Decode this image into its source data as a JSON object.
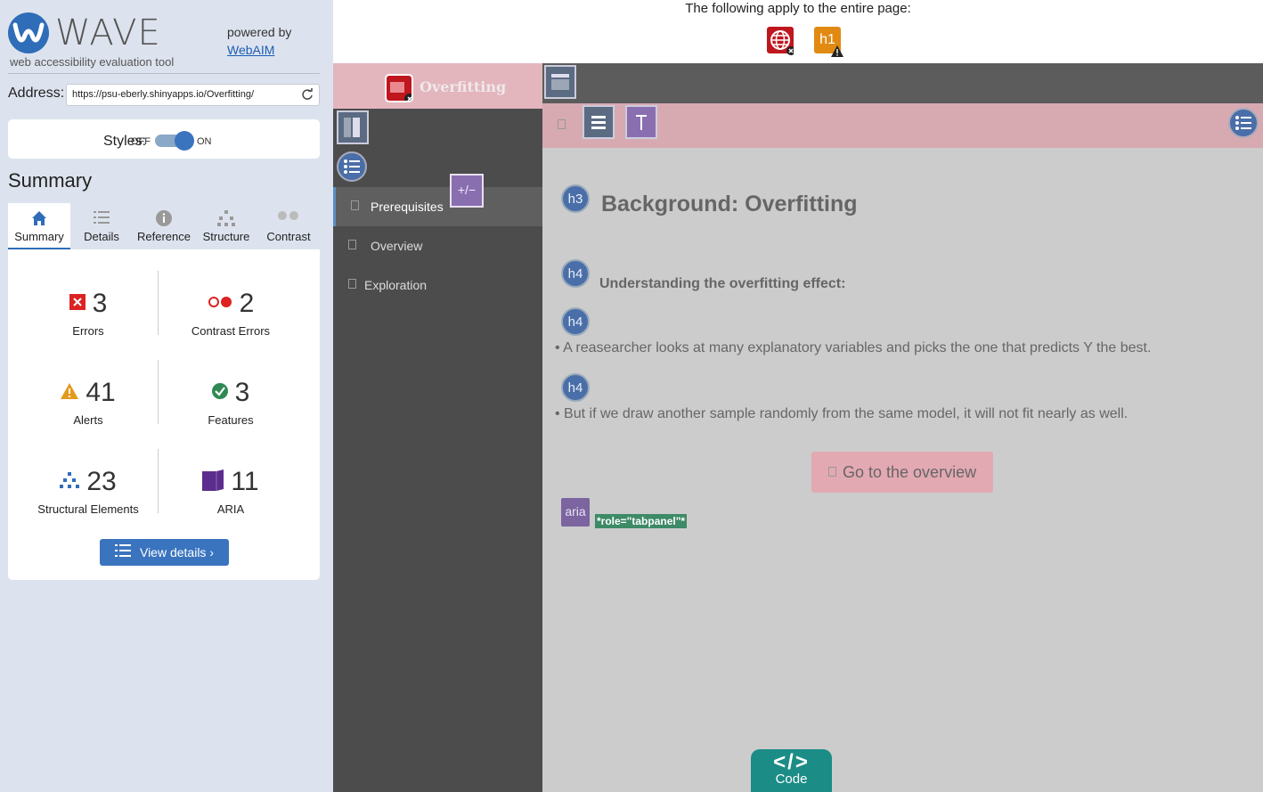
{
  "brand": {
    "name": "WAVE",
    "tagline": "web accessibility evaluation tool",
    "powered_by": "powered by",
    "powered_link": "WebAIM"
  },
  "address": {
    "label": "Address:",
    "value": "https://psu-eberly.shinyapps.io/Overfitting/"
  },
  "styles": {
    "label": "Styles:",
    "off": "OFF",
    "on": "ON",
    "state": "on"
  },
  "summary": {
    "title": "Summary",
    "tabs": [
      {
        "label": "Summary",
        "icon": "home-icon",
        "active": true
      },
      {
        "label": "Details",
        "icon": "list-icon"
      },
      {
        "label": "Reference",
        "icon": "info-icon"
      },
      {
        "label": "Structure",
        "icon": "structure-icon"
      },
      {
        "label": "Contrast",
        "icon": "contrast-icon"
      }
    ],
    "stats": [
      {
        "count": "3",
        "label": "Errors",
        "icon": "error-icon"
      },
      {
        "count": "2",
        "label": "Contrast Errors",
        "icon": "contrast-error-icon"
      },
      {
        "count": "41",
        "label": "Alerts",
        "icon": "alert-icon"
      },
      {
        "count": "3",
        "label": "Features",
        "icon": "feature-icon"
      },
      {
        "count": "23",
        "label": "Structural Elements",
        "icon": "structure-icon"
      },
      {
        "count": "11",
        "label": "ARIA",
        "icon": "aria-icon"
      }
    ],
    "view_details": "View details ›"
  },
  "page": {
    "apply_text": "The following apply to the entire page:",
    "page_icons": [
      {
        "name": "language-error-icon",
        "label": ""
      },
      {
        "name": "h1-alert-icon",
        "label": "h1"
      }
    ],
    "nav_title": "Overfitting",
    "nav_items": [
      {
        "label": "Prerequisites",
        "active": true
      },
      {
        "label": "Overview"
      },
      {
        "label": "Exploration"
      }
    ],
    "toggle_label": "+/−",
    "heading_h3": "Background: Overfitting",
    "heading_h4": "Understanding the overfitting effect:",
    "h3_badge": "h3",
    "h4_badge": "h4",
    "bullets": [
      "A reasearcher looks at many explanatory variables and picks the one that predicts Y the best.",
      "But if we draw another sample randomly from the same model, it will not fit nearly as well."
    ],
    "goto_button": "Go to the overview",
    "aria_badge": "aria",
    "role_tag": "*role=\"tabpanel\"*",
    "code_label": "Code",
    "code_icon": "</>"
  }
}
